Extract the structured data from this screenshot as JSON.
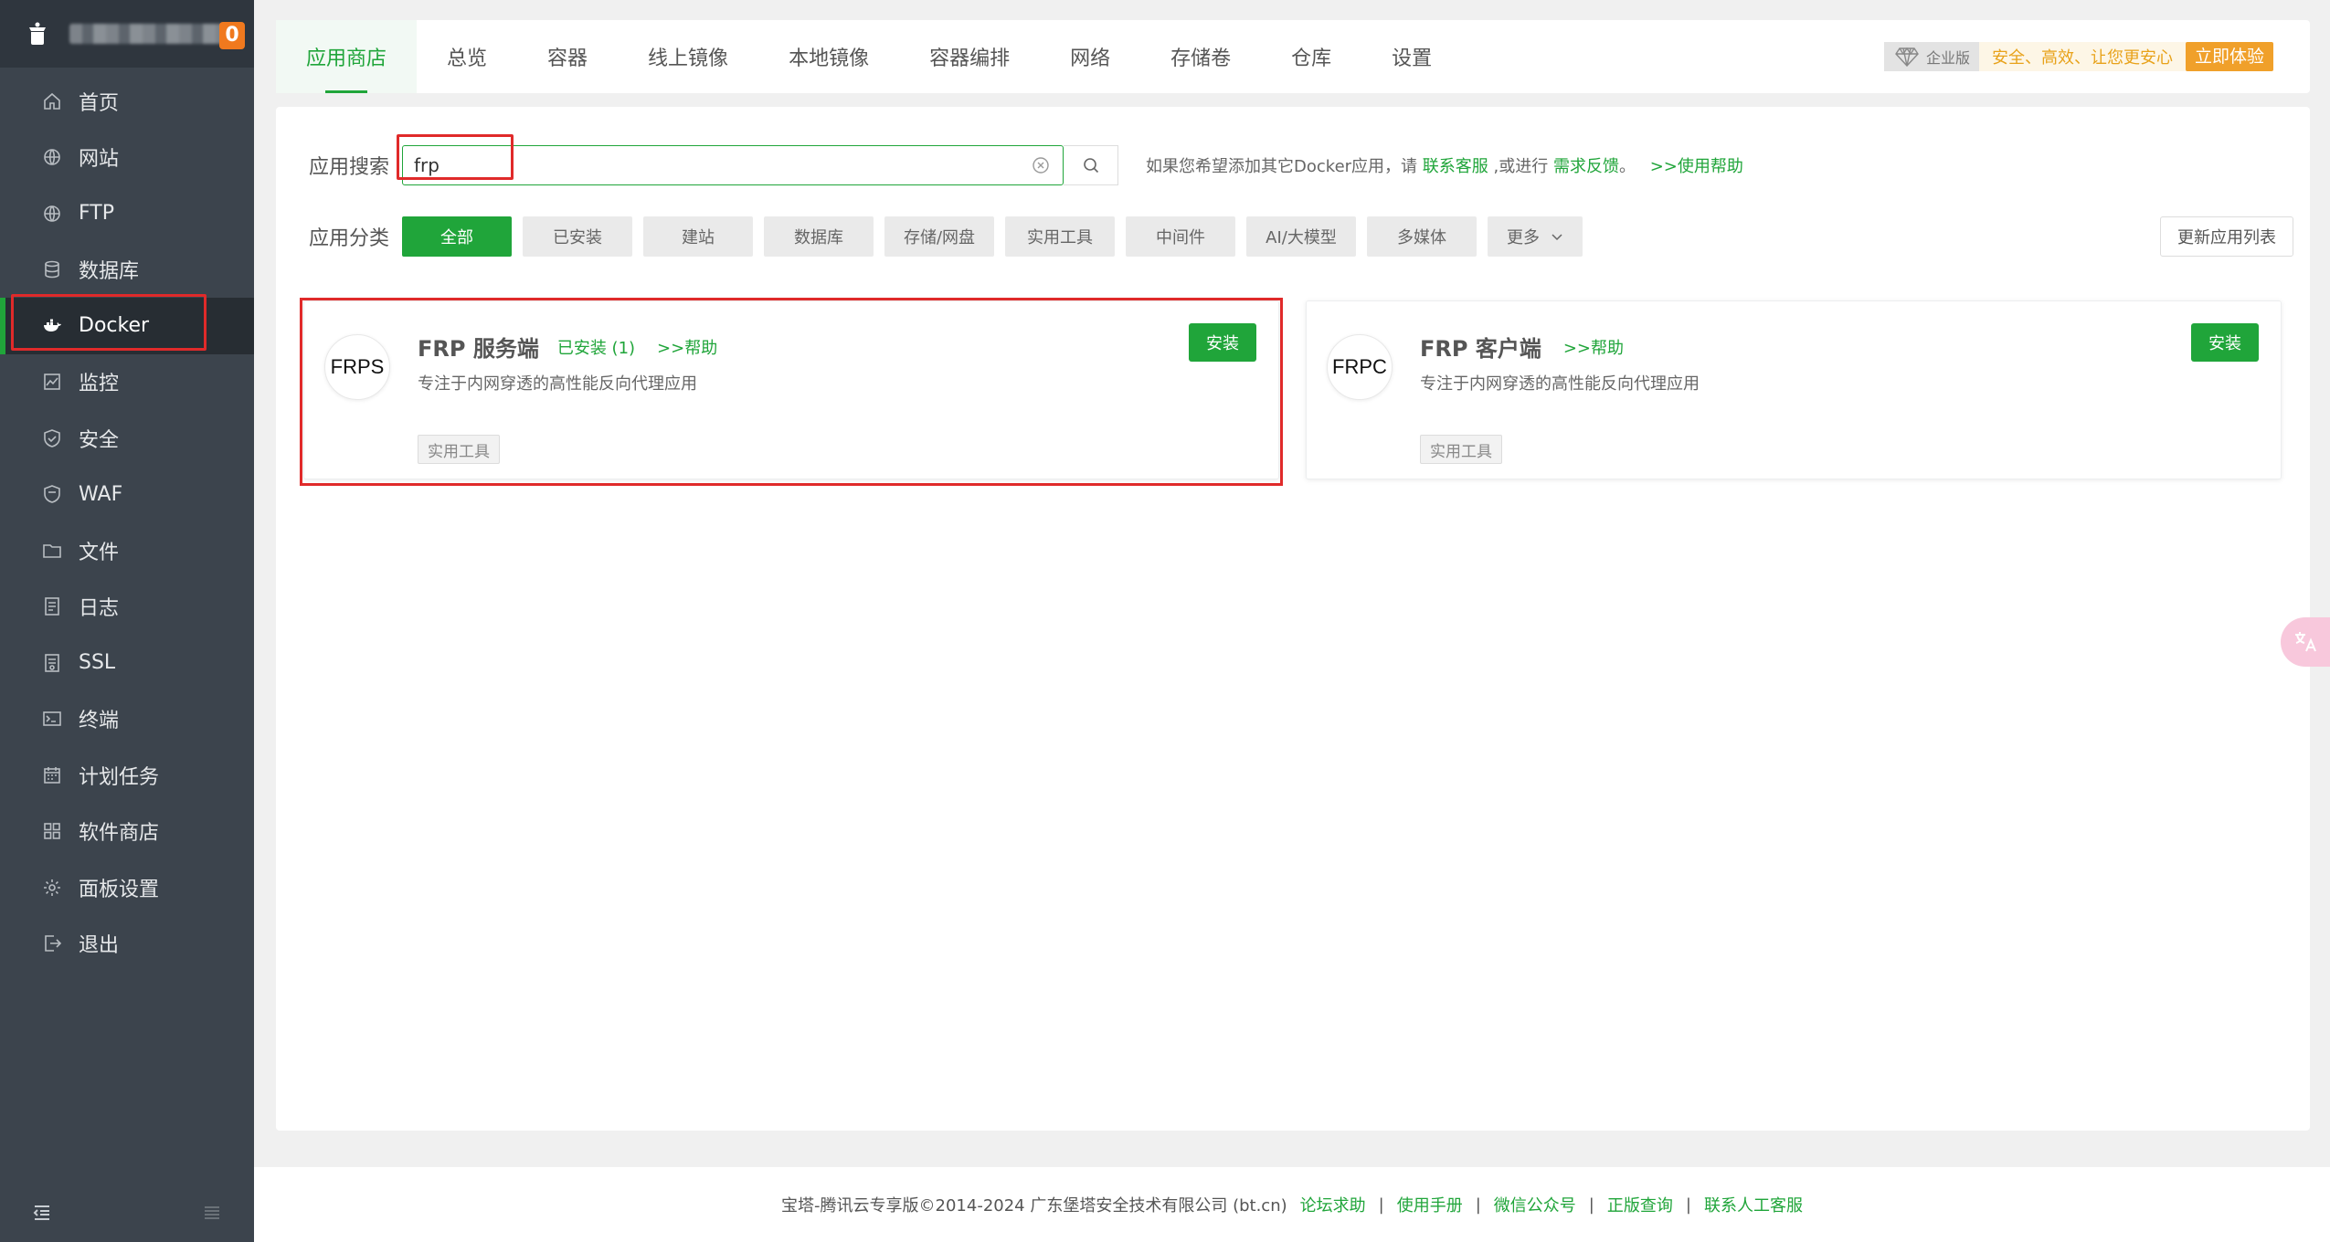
{
  "sidebar": {
    "badge": "0",
    "items": [
      {
        "label": "首页",
        "icon": "home-icon"
      },
      {
        "label": "网站",
        "icon": "globe-icon"
      },
      {
        "label": "FTP",
        "icon": "ftp-globe-icon"
      },
      {
        "label": "数据库",
        "icon": "database-icon"
      },
      {
        "label": "Docker",
        "icon": "docker-icon",
        "active": true
      },
      {
        "label": "监控",
        "icon": "monitor-icon"
      },
      {
        "label": "安全",
        "icon": "shield-icon"
      },
      {
        "label": "WAF",
        "icon": "waf-shield-icon"
      },
      {
        "label": "文件",
        "icon": "folder-icon"
      },
      {
        "label": "日志",
        "icon": "log-icon"
      },
      {
        "label": "SSL",
        "icon": "certificate-icon"
      },
      {
        "label": "终端",
        "icon": "terminal-icon"
      },
      {
        "label": "计划任务",
        "icon": "calendar-icon"
      },
      {
        "label": "软件商店",
        "icon": "grid-icon"
      },
      {
        "label": "面板设置",
        "icon": "gear-icon"
      },
      {
        "label": "退出",
        "icon": "logout-icon"
      }
    ]
  },
  "tabs": [
    "应用商店",
    "总览",
    "容器",
    "线上镜像",
    "本地镜像",
    "容器编排",
    "网络",
    "存储卷",
    "仓库",
    "设置"
  ],
  "enterprise": {
    "tag": "企业版",
    "slogan": "安全、高效、让您更安心",
    "button": "立即体验"
  },
  "search": {
    "label": "应用搜索",
    "value": "frp",
    "hint_prefix": "如果您希望添加其它Docker应用，请",
    "hint_link1": "联系客服",
    "hint_mid": ",或进行",
    "hint_link2": "需求反馈",
    "hint_sep": "。",
    "hint_link3": ">>使用帮助"
  },
  "category": {
    "label": "应用分类",
    "items": [
      "全部",
      "已安装",
      "建站",
      "数据库",
      "存储/网盘",
      "实用工具",
      "中间件",
      "AI/大模型",
      "多媒体"
    ],
    "more": "更多",
    "update_button": "更新应用列表"
  },
  "apps": [
    {
      "logo": "FRPS",
      "name": "FRP 服务端",
      "installed": "已安装 (1)",
      "help": ">>帮助",
      "desc": "专注于内网穿透的高性能反向代理应用",
      "tag": "实用工具",
      "install": "安装"
    },
    {
      "logo": "FRPC",
      "name": "FRP 客户端",
      "installed": "",
      "help": ">>帮助",
      "desc": "专注于内网穿透的高性能反向代理应用",
      "tag": "实用工具",
      "install": "安装"
    }
  ],
  "footer": {
    "copyright": "宝塔-腾讯云专享版©2014-2024 广东堡塔安全技术有限公司 (bt.cn)",
    "links": [
      "论坛求助",
      "使用手册",
      "微信公众号",
      "正版查询",
      "联系人工客服"
    ],
    "separator": "|"
  },
  "colors": {
    "accent": "#20a53a",
    "sidebar_bg": "#3c444d",
    "highlight": "#e02a2a",
    "badge": "#f0791e"
  }
}
